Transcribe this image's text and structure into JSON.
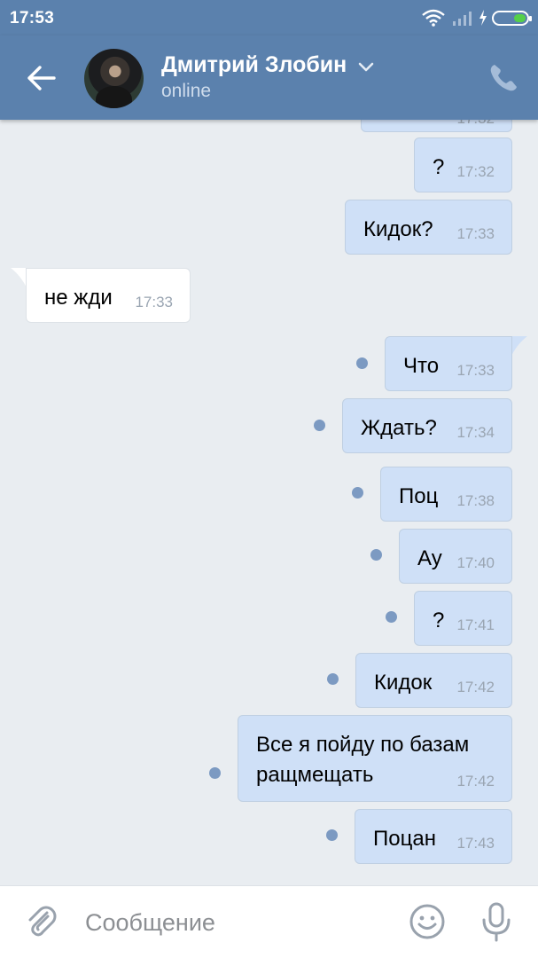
{
  "status_bar": {
    "time": "17:53"
  },
  "header": {
    "contact_name": "Дмитрий Злобин",
    "contact_status": "online",
    "icons": [
      "back-arrow-icon",
      "chevron-down-icon",
      "phone-icon"
    ]
  },
  "messages": [
    {
      "direction": "out",
      "text": "",
      "time": "17:32"
    },
    {
      "direction": "out",
      "text": "?",
      "time": "17:32",
      "unread": false
    },
    {
      "direction": "out",
      "text": "Кидок?",
      "time": "17:33",
      "unread": false
    },
    {
      "direction": "in",
      "text": "не жди",
      "time": "17:33"
    },
    {
      "direction": "out",
      "text": "Что",
      "time": "17:33",
      "unread": true
    },
    {
      "direction": "out",
      "text": "Ждать?",
      "time": "17:34",
      "unread": true
    },
    {
      "direction": "out",
      "text": "Поц",
      "time": "17:38",
      "unread": true
    },
    {
      "direction": "out",
      "text": "Ау",
      "time": "17:40",
      "unread": true
    },
    {
      "direction": "out",
      "text": "?",
      "time": "17:41",
      "unread": true
    },
    {
      "direction": "out",
      "text": "Кидок",
      "time": "17:42",
      "unread": true
    },
    {
      "direction": "out",
      "text": "Все я пойду по базам\nращмещать",
      "time": "17:42",
      "unread": true
    },
    {
      "direction": "out",
      "text": "Поцан",
      "time": "17:43",
      "unread": true
    }
  ],
  "composer": {
    "placeholder": "Сообщение",
    "value": "",
    "icons": [
      "paperclip-icon",
      "emoji-icon",
      "microphone-icon"
    ]
  },
  "colors": {
    "header": "#5b81ad",
    "background": "#e9edf1",
    "outgoing_bubble": "#cfe0f7",
    "incoming_bubble": "#ffffff",
    "unread_dot": "#7c9ac2",
    "battery": "#55d04a"
  }
}
